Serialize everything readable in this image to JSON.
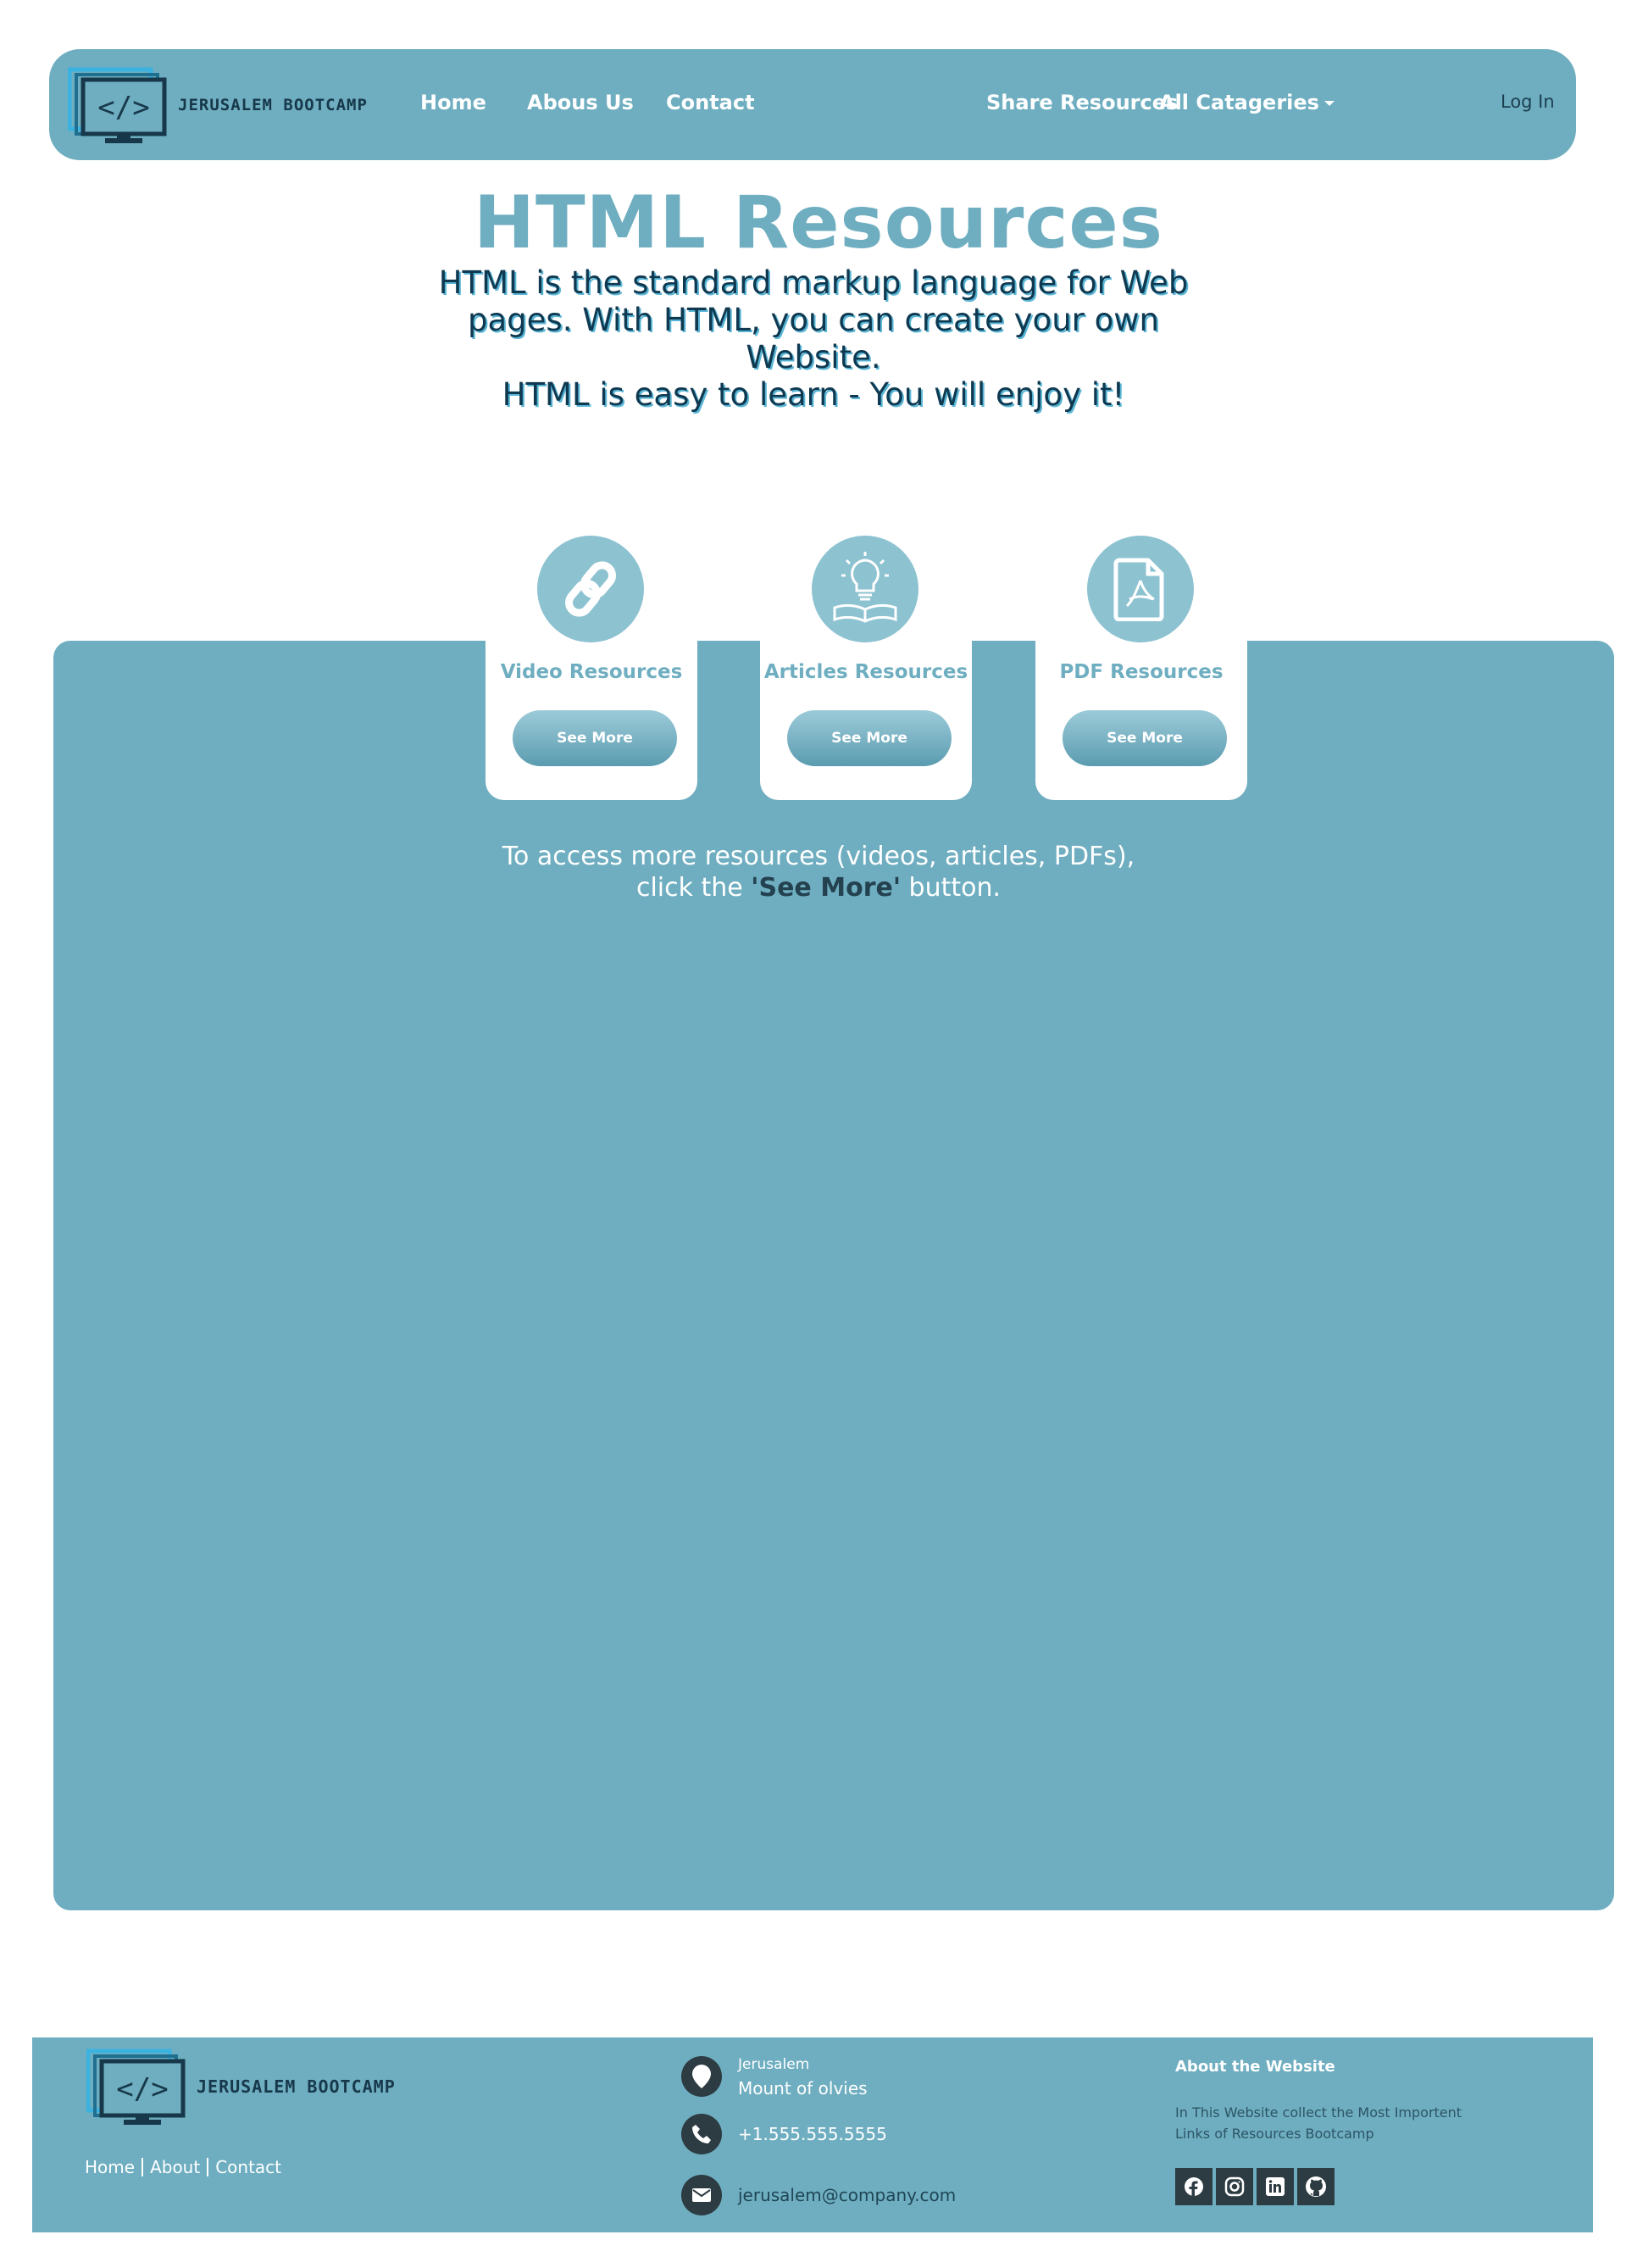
{
  "navbar": {
    "brand_text": "JERUSALEM BOOTCAMP",
    "links": {
      "home": "Home",
      "about": "Abous Us",
      "contact": "Contact"
    },
    "share": "Share Resources",
    "categories": "All Catageries",
    "login": "Log In"
  },
  "hero": {
    "title": "HTML Resources",
    "intro_lines": [
      "HTML is the standard markup language for Web",
      "pages. With HTML, you can create your own Website.",
      "HTML is easy to learn - You will enjoy it!"
    ]
  },
  "cards": [
    {
      "title": "Video Resources",
      "button": "See More",
      "icon": "link-icon"
    },
    {
      "title": "Articles Resources",
      "button": "See More",
      "icon": "lightbulb-book-icon"
    },
    {
      "title": "PDF Resources",
      "button": "See More",
      "icon": "pdf-file-icon"
    }
  ],
  "panel_note": {
    "line1": "To access more resources (videos, articles, PDFs),",
    "line2_before": "click the ",
    "line2_bold": "'See More'",
    "line2_after": " button."
  },
  "footer": {
    "brand_text": "JERUSALEM BOOTCAMP",
    "links": [
      "Home",
      "About",
      "Contact"
    ],
    "address_city": "Jerusalem",
    "address_street": "Mount of olvies",
    "phone": "+1.555.555.5555",
    "email": "jerusalem@company.com",
    "about_title": "About the Website",
    "about_text": "In This Website collect the Most Importent Links of Resources Bootcamp",
    "socials": [
      "facebook-icon",
      "instagram-icon",
      "linkedin-icon",
      "github-icon"
    ]
  },
  "colors": {
    "primary": "#6eaec0",
    "dark": "#0f3950",
    "icon_bg": "#8dc2d1",
    "social_bg": "#2d3b42"
  }
}
